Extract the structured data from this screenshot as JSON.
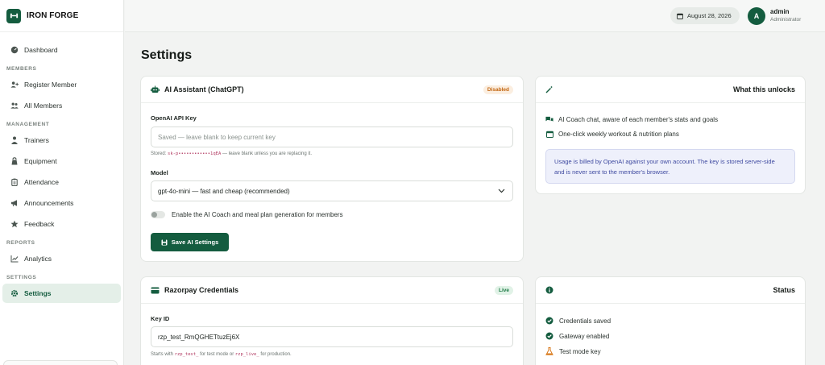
{
  "brand": {
    "name": "IRON FORGE"
  },
  "sidebar": {
    "dashboard": "Dashboard",
    "sections": {
      "members": "MEMBERS",
      "management": "MANAGEMENT",
      "reports": "REPORTS",
      "settings": "SETTINGS"
    },
    "items": {
      "register_member": "Register Member",
      "all_members": "All Members",
      "trainers": "Trainers",
      "equipment": "Equipment",
      "attendance": "Attendance",
      "announcements": "Announcements",
      "feedback": "Feedback",
      "analytics": "Analytics",
      "settings": "Settings"
    },
    "active": "settings"
  },
  "topbar": {
    "date": "August 28, 2026",
    "user": {
      "initial": "A",
      "name": "admin",
      "role": "Administrator"
    }
  },
  "page": {
    "title": "Settings"
  },
  "ai_card": {
    "title": "AI Assistant (ChatGPT)",
    "badge": "Disabled",
    "api_key_label": "OpenAI API Key",
    "api_key_placeholder": "Saved — leave blank to keep current key",
    "stored_prefix": "Stored:",
    "stored_key": "sk-p••••••••••••1qEA",
    "stored_suffix": "— leave blank unless you are replacing it.",
    "model_label": "Model",
    "model_value": "gpt-4o-mini — fast and cheap (recommended)",
    "toggle_label": "Enable the AI Coach and meal plan generation for members",
    "toggle_on": false,
    "save_button": "Save AI Settings"
  },
  "unlocks_card": {
    "title": "What this unlocks",
    "features": [
      "AI Coach chat, aware of each member's stats and goals",
      "One-click weekly workout & nutrition plans"
    ],
    "notice": "Usage is billed by OpenAI against your own account. The key is stored server-side and is never sent to the member's browser."
  },
  "razorpay_card": {
    "title": "Razorpay Credentials",
    "badge": "Live",
    "key_id_label": "Key ID",
    "key_id_value": "rzp_test_RmQGHETtuzEj6X",
    "hint_prefix": "Starts with",
    "hint_code1": "rzp_test_",
    "hint_mid": "for test mode or",
    "hint_code2": "rzp_live_",
    "hint_suffix": "for production."
  },
  "status_card": {
    "title": "Status",
    "items": [
      "Credentials saved",
      "Gateway enabled",
      "Test mode key"
    ]
  },
  "colors": {
    "brand": "#145c3f",
    "warning": "#c2650f",
    "success": "#1d7a45",
    "notice_text": "#3f4aa0",
    "flask": "#d97a1c"
  }
}
